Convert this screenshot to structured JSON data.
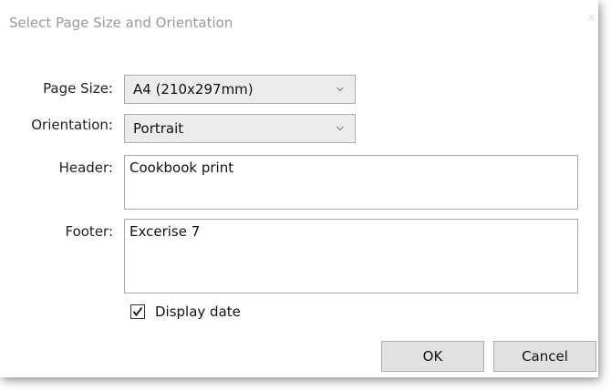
{
  "dialog": {
    "title": "Select Page Size and Orientation",
    "close_glyph": "✕"
  },
  "form": {
    "page_size": {
      "label": "Page Size:",
      "value": "A4 (210x297mm)"
    },
    "orientation": {
      "label": "Orientation:",
      "value": "Portrait"
    },
    "header": {
      "label": "Header:",
      "value": "Cookbook print"
    },
    "footer": {
      "label": "Footer:",
      "value": "Excerise 7"
    },
    "display_date": {
      "label": "Display date",
      "checked": true
    }
  },
  "buttons": {
    "ok_label": "OK",
    "cancel_label": "Cancel"
  },
  "icons": {
    "dropdown": "chevron-down-icon",
    "check": "checkmark-icon",
    "close": "close-icon"
  }
}
